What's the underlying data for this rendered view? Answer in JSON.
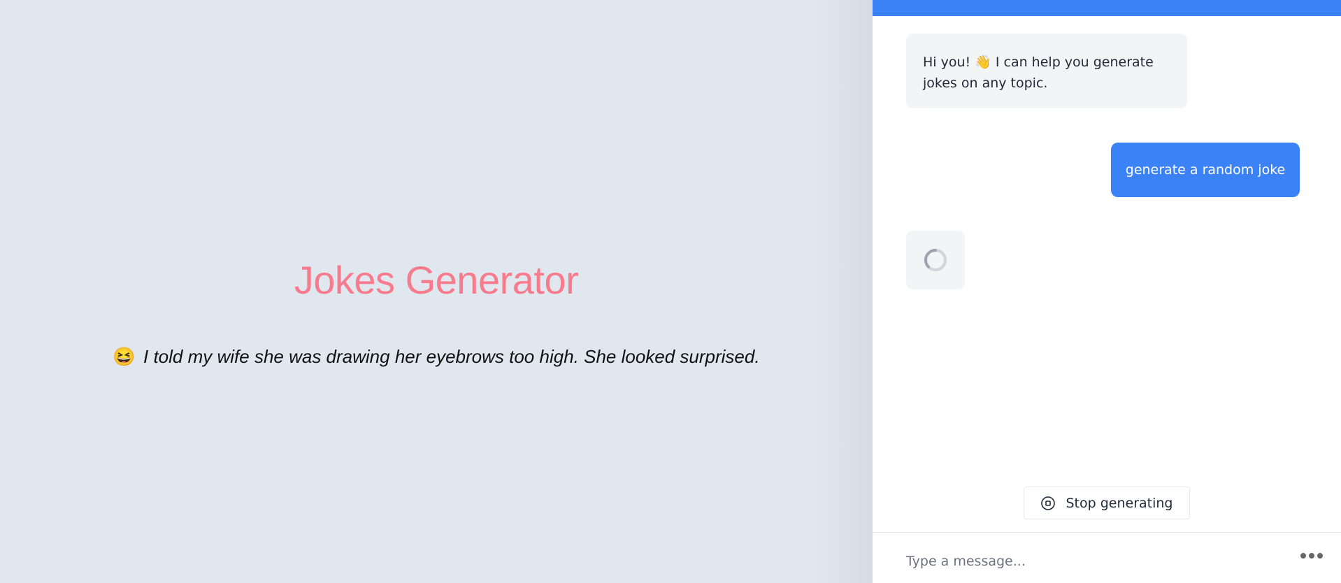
{
  "main": {
    "title": "Jokes Generator",
    "joke_emoji": "😆",
    "joke_text": "I told my wife she was drawing her eyebrows too high. She looked surprised.",
    "title_color": "#f77b8d",
    "background_color": "#e1e7ef"
  },
  "chat": {
    "header_color": "#3b82f6",
    "messages": [
      {
        "role": "assistant",
        "text": "Hi you! 👋 I can help you generate jokes on any topic."
      },
      {
        "role": "user",
        "text": "generate a random joke"
      },
      {
        "role": "assistant",
        "status": "loading",
        "icon": "spinner-icon"
      }
    ],
    "stop_button": {
      "label": "Stop generating",
      "icon": "stop-circle-icon"
    },
    "input": {
      "placeholder": "Type a message...",
      "value": ""
    },
    "more_button": {
      "icon": "more-dots-icon"
    }
  }
}
